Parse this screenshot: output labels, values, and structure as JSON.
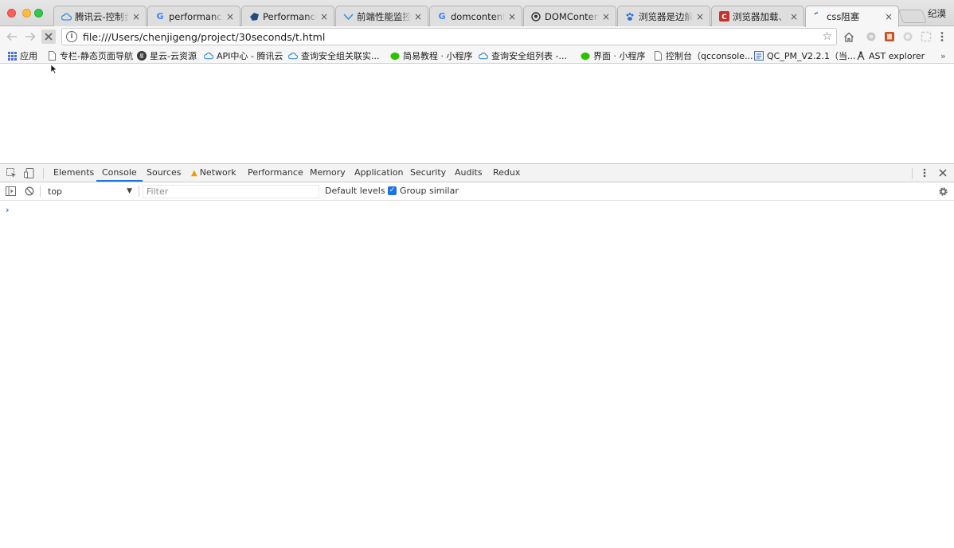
{
  "window": {
    "user_name": "纪漠"
  },
  "tabs": [
    {
      "title": "腾讯云-控制台",
      "icon": "cloud-icon",
      "close": "×"
    },
    {
      "title": "performance.timing",
      "icon": "google-icon",
      "close": "×"
    },
    {
      "title": "Performance.timing",
      "icon": "mdn-icon",
      "close": "×"
    },
    {
      "title": "前端性能监控：",
      "icon": "bird-icon",
      "close": "×"
    },
    {
      "title": "domcontentloaded",
      "icon": "google-icon",
      "close": "×"
    },
    {
      "title": "DOMContentLoaded",
      "icon": "github-icon",
      "close": "×"
    },
    {
      "title": "浏览器是边解析",
      "icon": "paw-icon",
      "close": "×"
    },
    {
      "title": "浏览器加载、解析",
      "icon": "csdn-icon",
      "close": "×"
    },
    {
      "title": "css阻塞",
      "icon": "loading-icon",
      "close": "×"
    }
  ],
  "toolbar": {
    "url": "file:///Users/chenjigeng/project/30seconds/t.html",
    "info_glyph": "i"
  },
  "bookmarks": [
    {
      "label": "应用",
      "icon": "apps-grid-icon"
    },
    {
      "label": "专栏-静态页面导航",
      "icon": "page-icon"
    },
    {
      "label": "星云-云资源",
      "icon": "nebula-icon"
    },
    {
      "label": "API中心 - 腾讯云",
      "icon": "cloud-icon"
    },
    {
      "label": "查询安全组关联实...",
      "icon": "cloud-icon"
    },
    {
      "label": "简易教程 · 小程序",
      "icon": "wechat-icon"
    },
    {
      "label": "查询安全组列表 -...",
      "icon": "cloud-icon"
    },
    {
      "label": "界面 · 小程序",
      "icon": "wechat-icon"
    },
    {
      "label": "控制台（qcconsole...",
      "icon": "page-icon"
    },
    {
      "label": "QC_PM_V2.2.1（当...",
      "icon": "doc-icon"
    },
    {
      "label": "AST explorer",
      "icon": "ast-icon"
    }
  ],
  "devtools": {
    "tabs": [
      "Elements",
      "Console",
      "Sources",
      "Network",
      "Performance",
      "Memory",
      "Application",
      "Security",
      "Audits",
      "Redux"
    ],
    "active_tab": "Console",
    "context": "top",
    "filter_placeholder": "Filter",
    "levels": "Default levels ▼",
    "group_similar": "Group similar",
    "prompt": "›"
  }
}
